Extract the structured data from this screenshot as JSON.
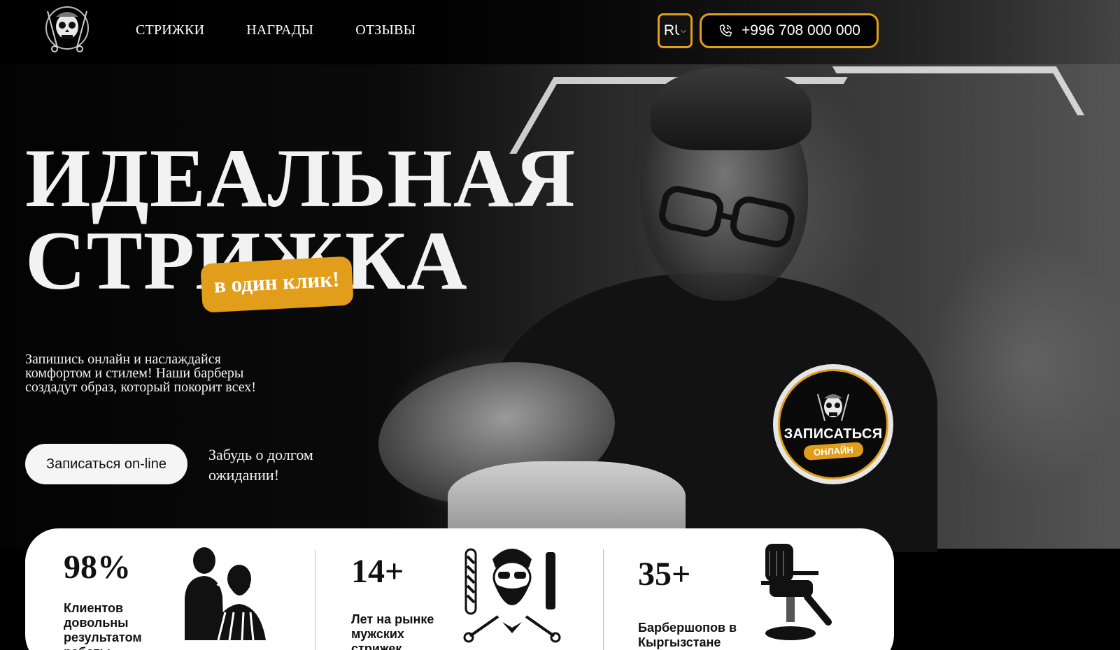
{
  "header": {
    "nav": [
      "СТРИЖКИ",
      "НАГРАДЫ",
      "ОТЗЫВЫ"
    ],
    "language": "RU",
    "phone": "+996 708 000 000"
  },
  "hero": {
    "title_line1": "ИДЕАЛЬНАЯ",
    "title_line2": "СТРИЖКА",
    "title_tag": "в один клик!",
    "subtitle": "Запишись онлайн и наслаждайся комфортом и стилем! Наши барберы создадут образ, который покорит всех!",
    "cta_label": "Записаться on-line",
    "cta_note": "Забудь о долгом ожидании!",
    "badge_title": "ЗАПИСАТЬСЯ",
    "badge_sub": "ОНЛАЙН"
  },
  "stats": [
    {
      "value": "98%",
      "label": "Клиентов довольны результатом работы"
    },
    {
      "value": "14+",
      "label": "Лет на рынке мужских стрижек"
    },
    {
      "value": "35+",
      "label": "Барбершопов в Кыргызстане"
    }
  ],
  "colors": {
    "accent": "#e29e1a",
    "background": "#000000",
    "card": "#ffffff"
  }
}
